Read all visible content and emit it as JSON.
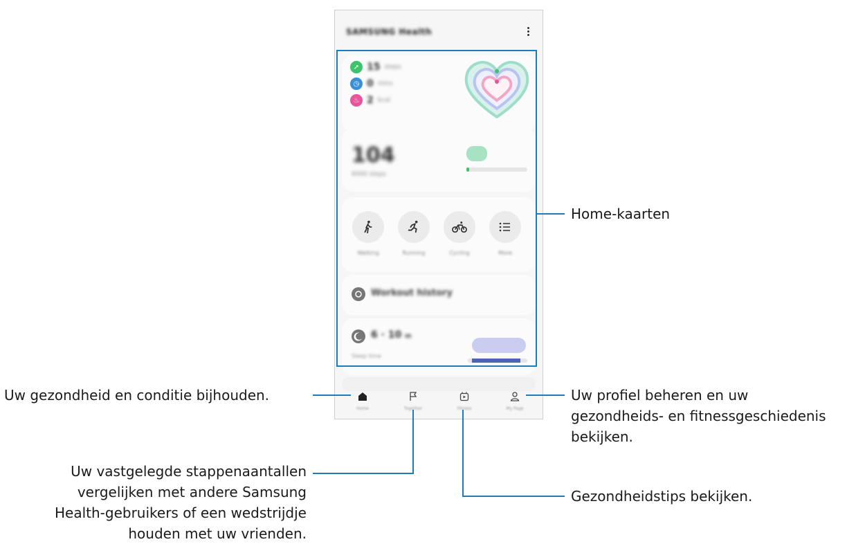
{
  "app": {
    "title": "SAMSUNG Health"
  },
  "home_cards": {
    "activity": {
      "steps_value": "15",
      "steps_unit": "steps",
      "minutes_value": "0",
      "minutes_unit": "mins",
      "kcal_value": "2",
      "kcal_unit": "kcal"
    },
    "steps": {
      "value": "104",
      "label": "6000 steps",
      "progress": 0.02
    },
    "workouts": [
      {
        "label": "Walking",
        "icon": "walking-icon"
      },
      {
        "label": "Running",
        "icon": "running-icon"
      },
      {
        "label": "Cycling",
        "icon": "cycling-icon"
      },
      {
        "label": "More",
        "icon": "list-icon"
      }
    ],
    "history": {
      "label": "Workout history"
    },
    "sleep": {
      "value": "6 · 10",
      "unit": "m",
      "label": "Sleep time"
    }
  },
  "tabs": [
    {
      "label": "Home",
      "icon": "home-icon"
    },
    {
      "label": "Together",
      "icon": "flag-icon"
    },
    {
      "label": "Fitness",
      "icon": "fitness-icon"
    },
    {
      "label": "My Page",
      "icon": "person-icon"
    }
  ],
  "callouts": {
    "home_cards": "Home-kaarten",
    "home_tab": "Uw gezondheid en conditie bijhouden.",
    "together_tab": [
      "Uw vastgelegde stappenaantallen",
      "vergelijken met andere Samsung",
      "Health-gebruikers of een wedstrijdje",
      "houden met uw vrienden."
    ],
    "my_page_tab": [
      "Uw profiel beheren en uw",
      "gezondheids- en fitnessgeschiedenis",
      "bekijken."
    ],
    "fitness_tab": "Gezondheidstips bekijken."
  },
  "colors": {
    "accent": "#1e7ab8",
    "steps_green": "#3cc36b",
    "minutes_blue": "#3a8fd6",
    "kcal_pink": "#e8559a",
    "sleep_bar": "#4d63b6"
  }
}
